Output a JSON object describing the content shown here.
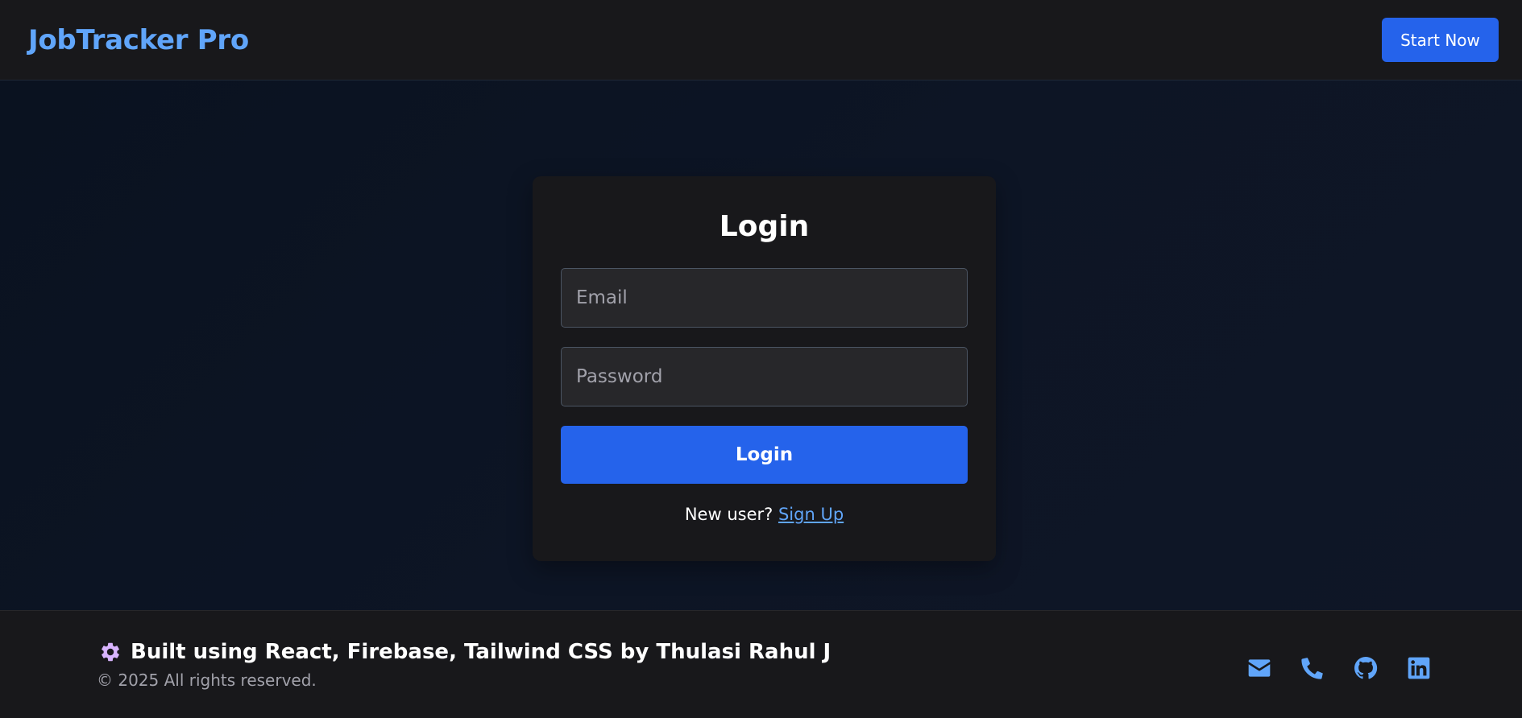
{
  "header": {
    "brand": "JobTracker Pro",
    "cta_label": "Start Now"
  },
  "login": {
    "title": "Login",
    "email_placeholder": "Email",
    "email_value": "",
    "password_placeholder": "Password",
    "password_value": "",
    "submit_label": "Login",
    "new_user_text": "New user?",
    "signup_label": "Sign Up"
  },
  "footer": {
    "gear_icon": "gear-icon",
    "built_text": "Built using React, Firebase, Tailwind CSS by Thulasi Rahul J",
    "copyright": "© 2025 All rights reserved.",
    "icons": [
      "envelope-icon",
      "phone-icon",
      "github-icon",
      "linkedin-icon"
    ]
  },
  "colors": {
    "accent": "#2563eb",
    "brand": "#60a5fa",
    "surface": "#18181b",
    "background": "#0b1220"
  }
}
